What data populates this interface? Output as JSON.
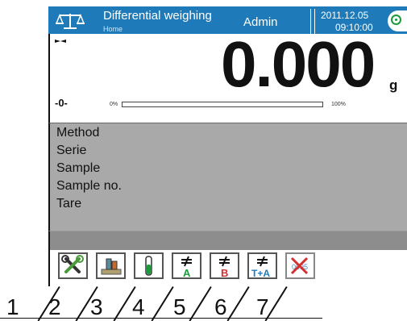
{
  "header": {
    "title": "Differential weighing",
    "subtitle": "Home",
    "user": "Admin",
    "date": "2011.12.05",
    "time": "09:10:00"
  },
  "weighing": {
    "value": "0.000",
    "unit": "g",
    "zero_indicator": "-0-",
    "progress_min_label": "0%",
    "progress_max_label": "100%",
    "progress_fraction": 0.0
  },
  "info_rows": [
    "Method",
    "Serie",
    "Sample",
    "Sample no.",
    "Tare"
  ],
  "toolbar": {
    "buttons": [
      {
        "icon": "tools-icon",
        "label": ""
      },
      {
        "icon": "sample-weighing-icon",
        "label": ""
      },
      {
        "icon": "test-tube-icon",
        "label": ""
      },
      {
        "icon": "not-equal-a-icon",
        "label": "A"
      },
      {
        "icon": "not-equal-b-icon",
        "label": "B"
      },
      {
        "icon": "not-equal-t-plus-a-icon",
        "label": "T+A"
      },
      {
        "icon": "delete-weighing-icon",
        "label": "0095"
      }
    ]
  },
  "callouts": [
    "1",
    "2",
    "3",
    "4",
    "5",
    "6",
    "7"
  ],
  "colors": {
    "header_bg": "#1e7ab8",
    "info_bg": "#a9a9a9",
    "strip_bg": "#8d8d8d",
    "green": "#1a9a3a",
    "red": "#d23030"
  }
}
